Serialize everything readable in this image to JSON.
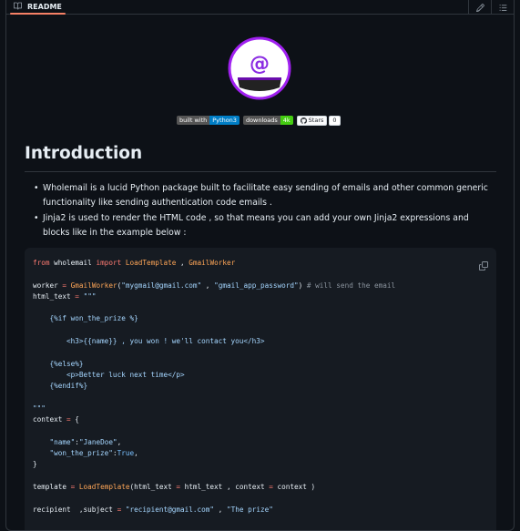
{
  "tab": {
    "label": "README"
  },
  "badges": {
    "built_with_left": "built with",
    "built_with_right": "Python3",
    "downloads_left": "downloads",
    "downloads_right": "4k",
    "stars_label": "Stars",
    "stars_count": "0"
  },
  "heading": "Introduction",
  "bullets": [
    "Wholemail is a lucid Python package built to facilitate easy sending of emails and other common generic functionality like sending authentication code emails .",
    "Jinja2 is used to render the HTML code , so that means you can add your own Jinja2 expressions and blocks like in the example below :"
  ],
  "code": {
    "l1": {
      "kw1": "from",
      "mod": " wholemail ",
      "kw2": "import",
      "c1": "LoadTemplate",
      "sep": " , ",
      "c2": "GmailWorker"
    },
    "l3": {
      "a": "worker ",
      "eq": "=",
      "cls": " GmailWorker",
      "p1": "(",
      "s1": "\"mygmail@gmail.com\"",
      "sep": " , ",
      "s2": "\"gmail_app_password\"",
      "p2": ")",
      "cm": " # will send the email"
    },
    "l4": {
      "a": "html_text ",
      "eq": "=",
      "s": " \"\"\""
    },
    "l6": "    {%if won_the_prize %}",
    "l8": "        <h3>{{name}} , you won ! we'll contact you</h3>",
    "l10": "    {%else%}",
    "l11": "        <p>Better luck next time</p>",
    "l12": "    {%endif%}",
    "l14": "\"\"\"",
    "l15": {
      "a": "context ",
      "eq": "=",
      "b": " {"
    },
    "l17": {
      "s": "    \"name\"",
      "p": ":",
      "v": "\"JaneDoe\"",
      "e": ","
    },
    "l18": {
      "s": "    \"won_the_prize\"",
      "p": ":",
      "v": "True",
      "e": ","
    },
    "l19": "}",
    "l21": {
      "a": "template ",
      "eq": "=",
      "cls": " LoadTemplate",
      "b": "(html_text ",
      "eq2": "=",
      "c": " html_text , context ",
      "eq3": "=",
      "d": " context )"
    },
    "l23": {
      "a": "recipient  ,subject ",
      "eq": "=",
      "s1": " \"recipient@gmail.com\"",
      "sep": " , ",
      "s2": "\"The prize\""
    }
  },
  "icons": [
    "book-icon",
    "pencil-icon",
    "list-icon",
    "copy-icon",
    "github-icon"
  ]
}
